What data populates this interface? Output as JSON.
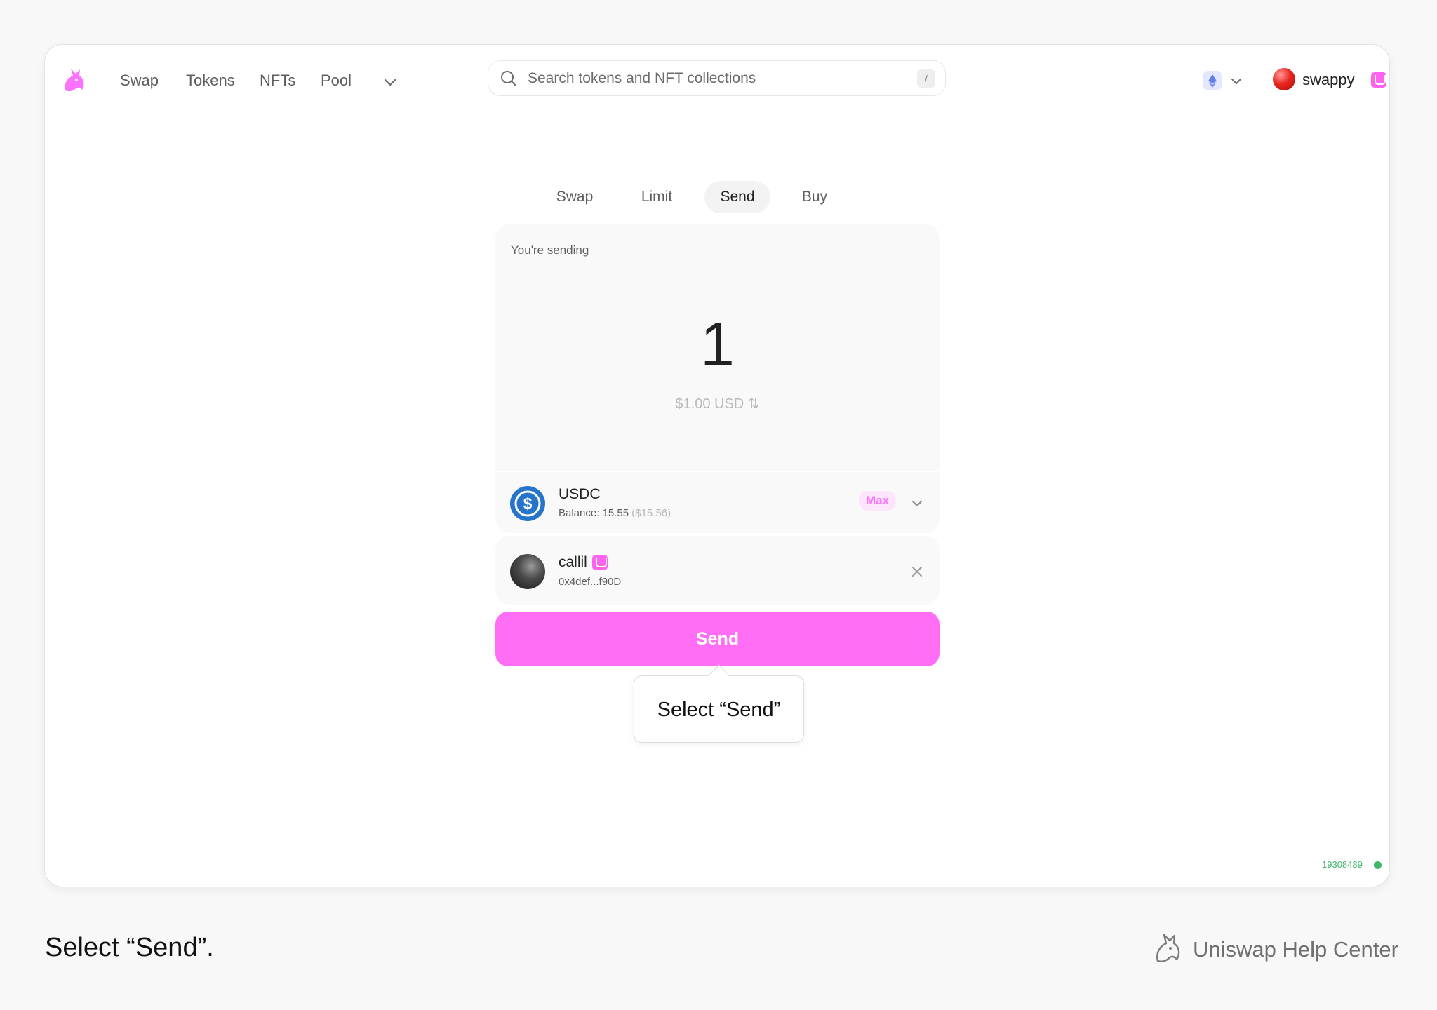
{
  "nav": {
    "links": [
      "Swap",
      "Tokens",
      "NFTs",
      "Pool"
    ]
  },
  "search": {
    "placeholder": "Search tokens and NFT collections",
    "shortcut": "/"
  },
  "account": {
    "name": "swappy"
  },
  "tabs": [
    "Swap",
    "Limit",
    "Send",
    "Buy"
  ],
  "active_tab": "Send",
  "send": {
    "label": "You're sending",
    "amount": "1",
    "usd_value": "$1.00 USD ⇅"
  },
  "token": {
    "symbol": "USDC",
    "balance": "Balance: 15.55",
    "balance_usd": "($15.56)",
    "max_label": "Max"
  },
  "recipient": {
    "name": "callil",
    "address": "0x4def...f90D"
  },
  "send_button_label": "Send",
  "tooltip": "Select “Send”",
  "block_number": "19308489",
  "caption": "Select “Send”.",
  "help_center": "Uniswap Help Center",
  "colors": {
    "accent": "#FC72FF",
    "button": "#FF6EF5",
    "usdc": "#2775CA",
    "status": "#40B66B"
  }
}
